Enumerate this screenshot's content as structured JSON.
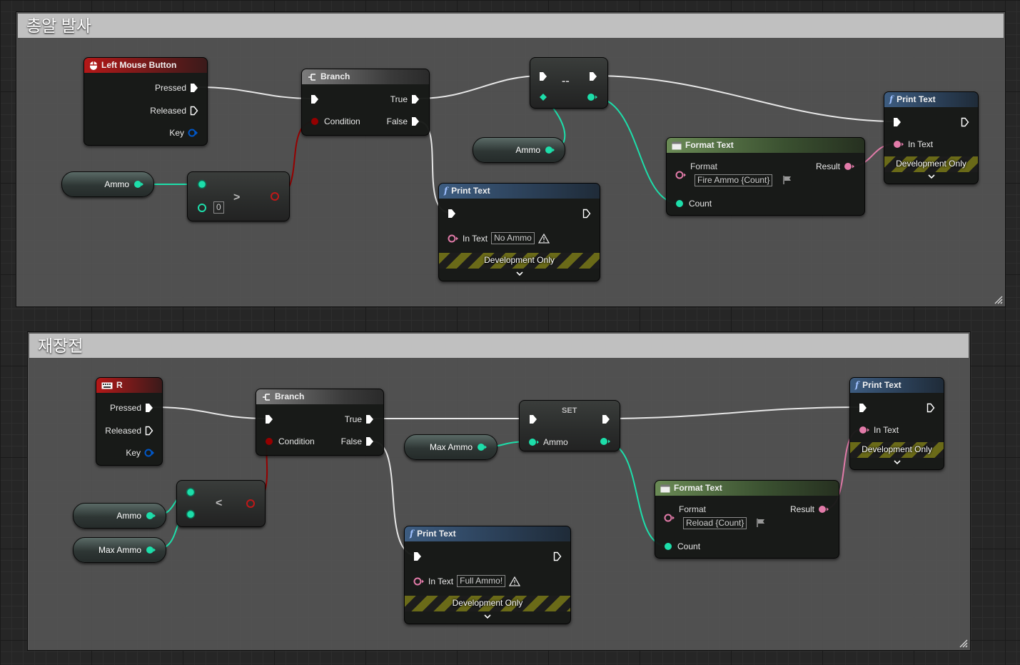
{
  "colors": {
    "exec": "#ffffff",
    "bool": "#950000",
    "int": "#1ddeaa",
    "string": "#fb5bd7",
    "text": "#e27ba9",
    "struct": "#0057c8"
  },
  "comments": [
    {
      "title": "총알 발사"
    },
    {
      "title": "재장전"
    }
  ],
  "fire": {
    "event": {
      "title": "Left Mouse Button",
      "icon": "mouse-icon",
      "pressed": "Pressed",
      "released": "Released",
      "key": "Key"
    },
    "ammo_get": {
      "label": "Ammo"
    },
    "compare": {
      "symbol": ">",
      "value": "0"
    },
    "branch": {
      "title": "Branch",
      "true": "True",
      "false": "False",
      "condition": "Condition"
    },
    "decrement": {
      "symbol": "--"
    },
    "ammo_get2": {
      "label": "Ammo"
    },
    "print_no_ammo": {
      "title": "Print Text",
      "in_text": "In Text",
      "value": "No Ammo",
      "dev": "Development Only"
    },
    "format": {
      "title": "Format Text",
      "format": "Format",
      "result": "Result",
      "value": "Fire Ammo {Count}",
      "count": "Count"
    },
    "print": {
      "title": "Print Text",
      "in_text": "In Text",
      "dev": "Development Only"
    }
  },
  "reload": {
    "event": {
      "title": "R",
      "icon": "keyboard-icon",
      "pressed": "Pressed",
      "released": "Released",
      "key": "Key"
    },
    "ammo_get": {
      "label": "Ammo"
    },
    "max_get": {
      "label": "Max Ammo"
    },
    "compare": {
      "symbol": "<"
    },
    "branch": {
      "title": "Branch",
      "true": "True",
      "false": "False",
      "condition": "Condition"
    },
    "max_get2": {
      "label": "Max Ammo"
    },
    "set": {
      "title": "SET",
      "ammo": "Ammo"
    },
    "print_full": {
      "title": "Print Text",
      "in_text": "In Text",
      "value": "Full Ammo!",
      "dev": "Development Only"
    },
    "format": {
      "title": "Format Text",
      "format": "Format",
      "result": "Result",
      "value": "Reload {Count}",
      "count": "Count"
    },
    "print": {
      "title": "Print Text",
      "in_text": "In Text",
      "dev": "Development Only"
    }
  }
}
